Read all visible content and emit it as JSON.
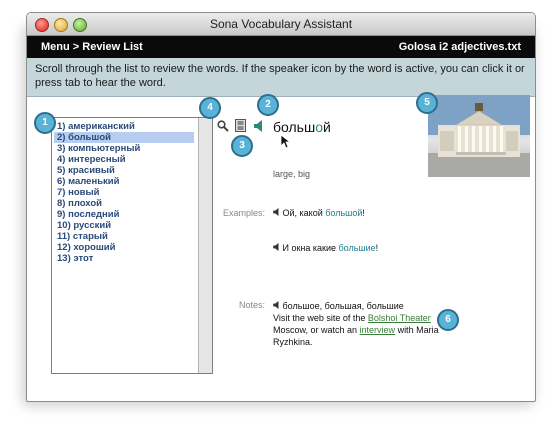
{
  "window": {
    "title": "Sona Vocabulary Assistant"
  },
  "nav": {
    "breadcrumb": "Menu  > Review List",
    "file": "Golosa i2 adjectives.txt"
  },
  "instruction": "Scroll through the list to review the words. If the speaker icon by the word is active, you can click it or press tab to hear the word.",
  "words": [
    "1) американский",
    "2) большой",
    "3) компьютерный",
    "4) интересный",
    "5) красивый",
    "6) маленький",
    "7) новый",
    "8) плохой",
    "9) последний",
    "10) русский",
    "11) старый",
    "12) хороший",
    "13) этот"
  ],
  "selected_index": 1,
  "detail": {
    "word_pre": "больш",
    "word_accent": "о",
    "word_post": "й",
    "meaning": "large, big",
    "examples_label": "Examples:",
    "example1_pre": "Ой, какой ",
    "example1_hl": "большой",
    "example1_post": "!",
    "example2_pre": "И окна какие ",
    "example2_hl": "большие",
    "example2_post": "!",
    "notes_label": "Notes:",
    "notes_forms": "большое, большая, большие",
    "notes_line2_pre": "Visit the web site of the ",
    "notes_link1": "Bolshoi Theater",
    "notes_line3_pre": "Moscow, or watch an ",
    "notes_link2": "interview",
    "notes_line3_post": " with Maria",
    "notes_line4": "Ryzhkina."
  },
  "callouts": [
    "1",
    "2",
    "3",
    "4",
    "5",
    "6"
  ],
  "icons": {
    "search": "magnifier-icon",
    "video": "film-icon",
    "speaker": "speaker-icon"
  },
  "colors": {
    "accent": "#1f7f8f",
    "callout": "#5ab3d6",
    "selection": "#b6cdf0",
    "link": "#3a7d3a"
  }
}
